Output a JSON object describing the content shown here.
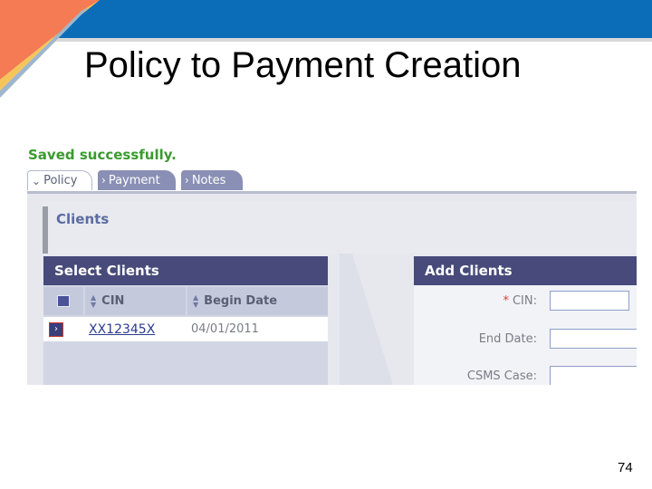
{
  "slide": {
    "title": "Policy to Payment Creation",
    "page_number": "74"
  },
  "app": {
    "status_message": "Saved successfully.",
    "tabs": [
      {
        "label": "Policy",
        "icon": "chevron-down-icon",
        "active": true
      },
      {
        "label": "Payment",
        "icon": "chevron-right-icon",
        "active": false
      },
      {
        "label": "Notes",
        "icon": "chevron-right-icon",
        "active": false
      }
    ],
    "clients_heading": "Clients",
    "select_clients": {
      "title": "Select Clients",
      "columns": [
        "CIN",
        "Begin Date"
      ],
      "rows": [
        {
          "cin": "XX12345X",
          "begin_date": "04/01/2011"
        }
      ]
    },
    "add_clients": {
      "title": "Add Clients",
      "fields": [
        {
          "label": "CIN:",
          "required": true,
          "required_marker": "*"
        },
        {
          "label": "End Date:",
          "required": false
        },
        {
          "label": "CSMS Case:",
          "required": false
        }
      ]
    }
  },
  "colors": {
    "header_band": "#0b6db7",
    "panel_header": "#474a7a",
    "success_text": "#3a9b2e",
    "tab_inactive": "#8a8fb5"
  }
}
